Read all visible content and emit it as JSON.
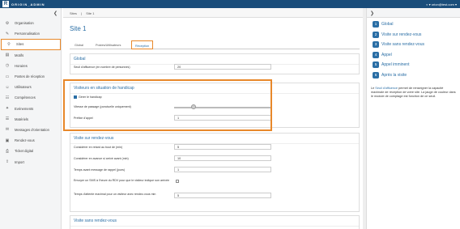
{
  "topbar": {
    "logo": "R",
    "brand": "ORIGIN_ADMIN",
    "user": "◐ ▾     orion@test.com ▾"
  },
  "sidebar": {
    "collapse": "❮",
    "items": [
      {
        "icon": "⚙",
        "label": "Organisation",
        "name": "sidebar-item-organisation"
      },
      {
        "icon": "✎",
        "label": "Personnalisation",
        "name": "sidebar-item-personnalisation"
      },
      {
        "icon": "⚲",
        "label": "Sites",
        "name": "sidebar-item-sites",
        "active": true
      },
      {
        "icon": "▤",
        "label": "Motifs",
        "name": "sidebar-item-motifs"
      },
      {
        "icon": "◷",
        "label": "Horaires",
        "name": "sidebar-item-horaires"
      },
      {
        "icon": "▭",
        "label": "Postes de réception",
        "name": "sidebar-item-postes"
      },
      {
        "icon": "☺",
        "label": "Utilisateurs",
        "name": "sidebar-item-utilisateurs"
      },
      {
        "icon": "☷",
        "label": "Compétences",
        "name": "sidebar-item-competences"
      },
      {
        "icon": "✦",
        "label": "Evénements",
        "name": "sidebar-item-evenements"
      },
      {
        "icon": "☰",
        "label": "Matériels",
        "name": "sidebar-item-materiels"
      },
      {
        "icon": "✉",
        "label": "Messages d'orientation",
        "name": "sidebar-item-messages"
      },
      {
        "icon": "▣",
        "label": "Rendez-vous",
        "name": "sidebar-item-rendezvous"
      },
      {
        "icon": "⎙",
        "label": "Ticket digital",
        "name": "sidebar-item-ticket"
      },
      {
        "icon": "⇪",
        "label": "Import",
        "name": "sidebar-item-import"
      }
    ]
  },
  "breadcrumb": {
    "root": "Sites",
    "sep": "|",
    "current": "Site 1"
  },
  "page": {
    "title": "Site 1"
  },
  "tabs": [
    {
      "label": "Global"
    },
    {
      "label": "Postes/Utilisateurs"
    },
    {
      "label": "Réception"
    }
  ],
  "global_panel": {
    "title": "Global",
    "seuil_label": "Seuil d'affluence (en nombre de personnes)",
    "seuil_value": "20"
  },
  "handicap_panel": {
    "title": "Visiteurs en situation de handicap",
    "gerer_label": "Gérer le handicap",
    "gerer_checked": true,
    "vitesse_label": "Vitesse de passage (ponctuelle uniquement)",
    "vitesse_level": 0.2,
    "prefixe_label": "Préfixe d'appel",
    "prefixe_value": "1"
  },
  "rdv_panel": {
    "title": "Visite sur rendez-vous",
    "rows": [
      {
        "label": "Considérer en retard au bout de (min)",
        "value": "5"
      },
      {
        "label": "Considérer en avance si arrivé avant (min)",
        "value": "10"
      },
      {
        "label": "Temps avant message de rappel (jours)",
        "value": "1"
      },
      {
        "label": "Envoyer un SMS à l'heure du RDV pour que le visiteur indique son arrivée",
        "value": ""
      },
      {
        "label": "Temps d'attente maximal pour un visiteur avec rendez-vous min",
        "value": "5"
      }
    ]
  },
  "sans_rdv_panel": {
    "title": "Visite sans rendez-vous"
  },
  "help": {
    "close": "❯",
    "steps": [
      {
        "num": "1",
        "label": "Global"
      },
      {
        "num": "2",
        "label": "Visite sur rendez-vous"
      },
      {
        "num": "3",
        "label": "Visite sans rendez-vous"
      },
      {
        "num": "4",
        "label": "Appel"
      },
      {
        "num": "5",
        "label": "Appel imminent"
      },
      {
        "num": "6",
        "label": "Après la visite"
      }
    ],
    "text_pre": "Le ",
    "text_link": "Seuil d'affluence",
    "text_post": " permet de renseigner la capacité maximale de réception de votre site. La jauge de couleur dans le module de comptage est fonction de ce seuil."
  }
}
